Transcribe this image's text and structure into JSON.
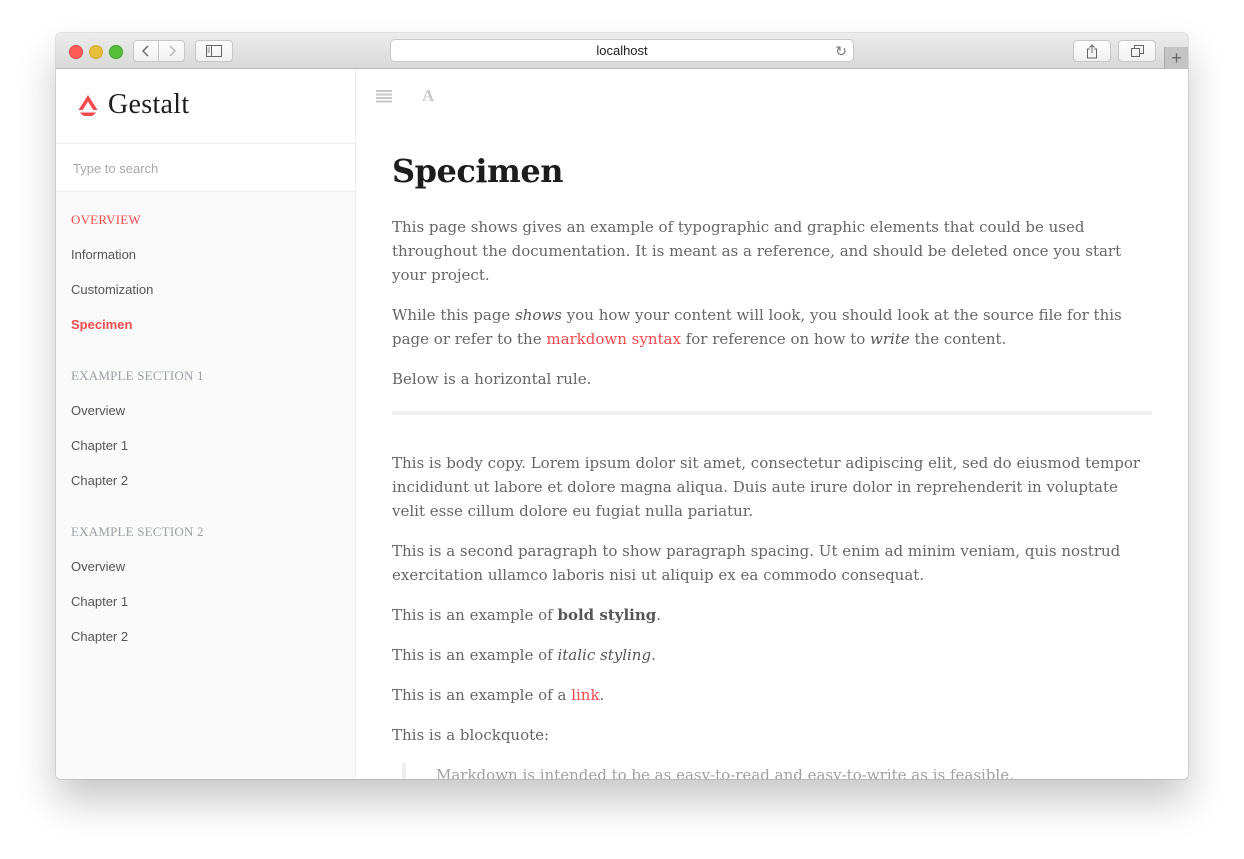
{
  "browser": {
    "url": "localhost",
    "icons": {
      "close": "close-dot",
      "minimize": "minimize-dot",
      "maximize": "maximize-dot",
      "back": "chevron-left-icon",
      "forward": "chevron-right-icon",
      "sidebar": "sidebar-icon",
      "reload": "reload-icon",
      "share": "share-icon",
      "tabs": "tabs-icon",
      "new_tab": "plus-icon"
    },
    "new_tab_label": "+",
    "reload_glyph": "↻"
  },
  "sidebar": {
    "brand": "Gestalt",
    "search_placeholder": "Type to search",
    "sections": [
      {
        "title": "OVERVIEW",
        "active": true,
        "items": [
          {
            "label": "Information"
          },
          {
            "label": "Customization"
          },
          {
            "label": "Specimen",
            "current": true
          }
        ]
      },
      {
        "title": "EXAMPLE SECTION 1",
        "items": [
          {
            "label": "Overview"
          },
          {
            "label": "Chapter 1"
          },
          {
            "label": "Chapter 2"
          }
        ]
      },
      {
        "title": "EXAMPLE SECTION 2",
        "items": [
          {
            "label": "Overview"
          },
          {
            "label": "Chapter 1"
          },
          {
            "label": "Chapter 2"
          }
        ]
      }
    ]
  },
  "toolbar": {
    "menu_icon": "menu-lines-icon",
    "font_icon_glyph": "A"
  },
  "content": {
    "title": "Specimen",
    "p1": "This page shows gives an example of typographic and graphic elements that could be used throughout the documentation. It is meant as a reference, and should be deleted once you start your project.",
    "p2": {
      "a": "While this page ",
      "em1": "shows",
      "b": " you how your content will look, you should look at the source file for this page or refer to the ",
      "link": "markdown syntax",
      "c": " for reference on how to ",
      "em2": "write",
      "d": " the content."
    },
    "p3": "Below is a horizontal rule.",
    "p4": "This is body copy. Lorem ipsum dolor sit amet, consectetur adipiscing elit, sed do eiusmod tempor incididunt ut labore et dolore magna aliqua. Duis aute irure dolor in reprehenderit in voluptate velit esse cillum dolore eu fugiat nulla pariatur.",
    "p5": "This is a second paragraph to show paragraph spacing. Ut enim ad minim veniam, quis nostrud exercitation ullamco laboris nisi ut aliquip ex ea commodo consequat.",
    "bold_line": {
      "a": "This is an example of ",
      "strong": "bold styling",
      "b": "."
    },
    "italic_line": {
      "a": "This is an example of ",
      "em": "italic styling",
      "b": "."
    },
    "link_line": {
      "a": "This is an example of a ",
      "link": "link",
      "b": "."
    },
    "blockquote_intro": "This is a blockquote:",
    "blockquote": "Markdown is intended to be as easy-to-read and easy-to-write as is feasible."
  },
  "colors": {
    "accent": "#f34a4f",
    "section_muted": "#9aa0a6",
    "body_text": "#666666",
    "heading": "#1c1c1c"
  }
}
